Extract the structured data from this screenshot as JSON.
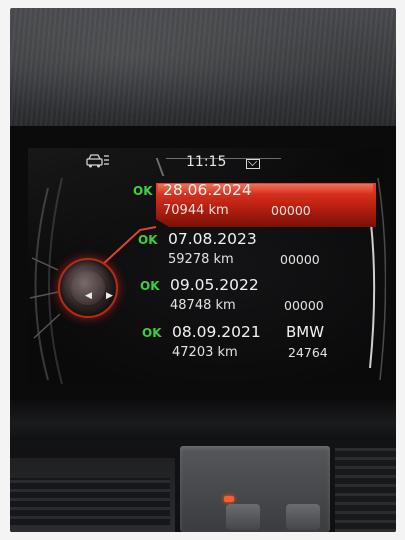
{
  "status": {
    "time": "11:15"
  },
  "entries": [
    {
      "status": "OK",
      "date": "28.06.2024",
      "mileage": "70944 km",
      "code": "00000"
    },
    {
      "status": "OK",
      "date": "07.08.2023",
      "mileage": "59278 km",
      "code": "00000"
    },
    {
      "status": "OK",
      "date": "09.05.2022",
      "mileage": "48748 km",
      "code": "00000"
    },
    {
      "status": "OK",
      "date": "08.09.2021",
      "mileage": "47203 km",
      "code": "24764",
      "brand": "BMW"
    }
  ],
  "icons": [
    "car-service-icon",
    "mail-icon",
    "controller-knob-icon"
  ],
  "colors": {
    "highlight": "#c32414",
    "ok": "#3fcf38",
    "text": "#f2f2f2"
  }
}
